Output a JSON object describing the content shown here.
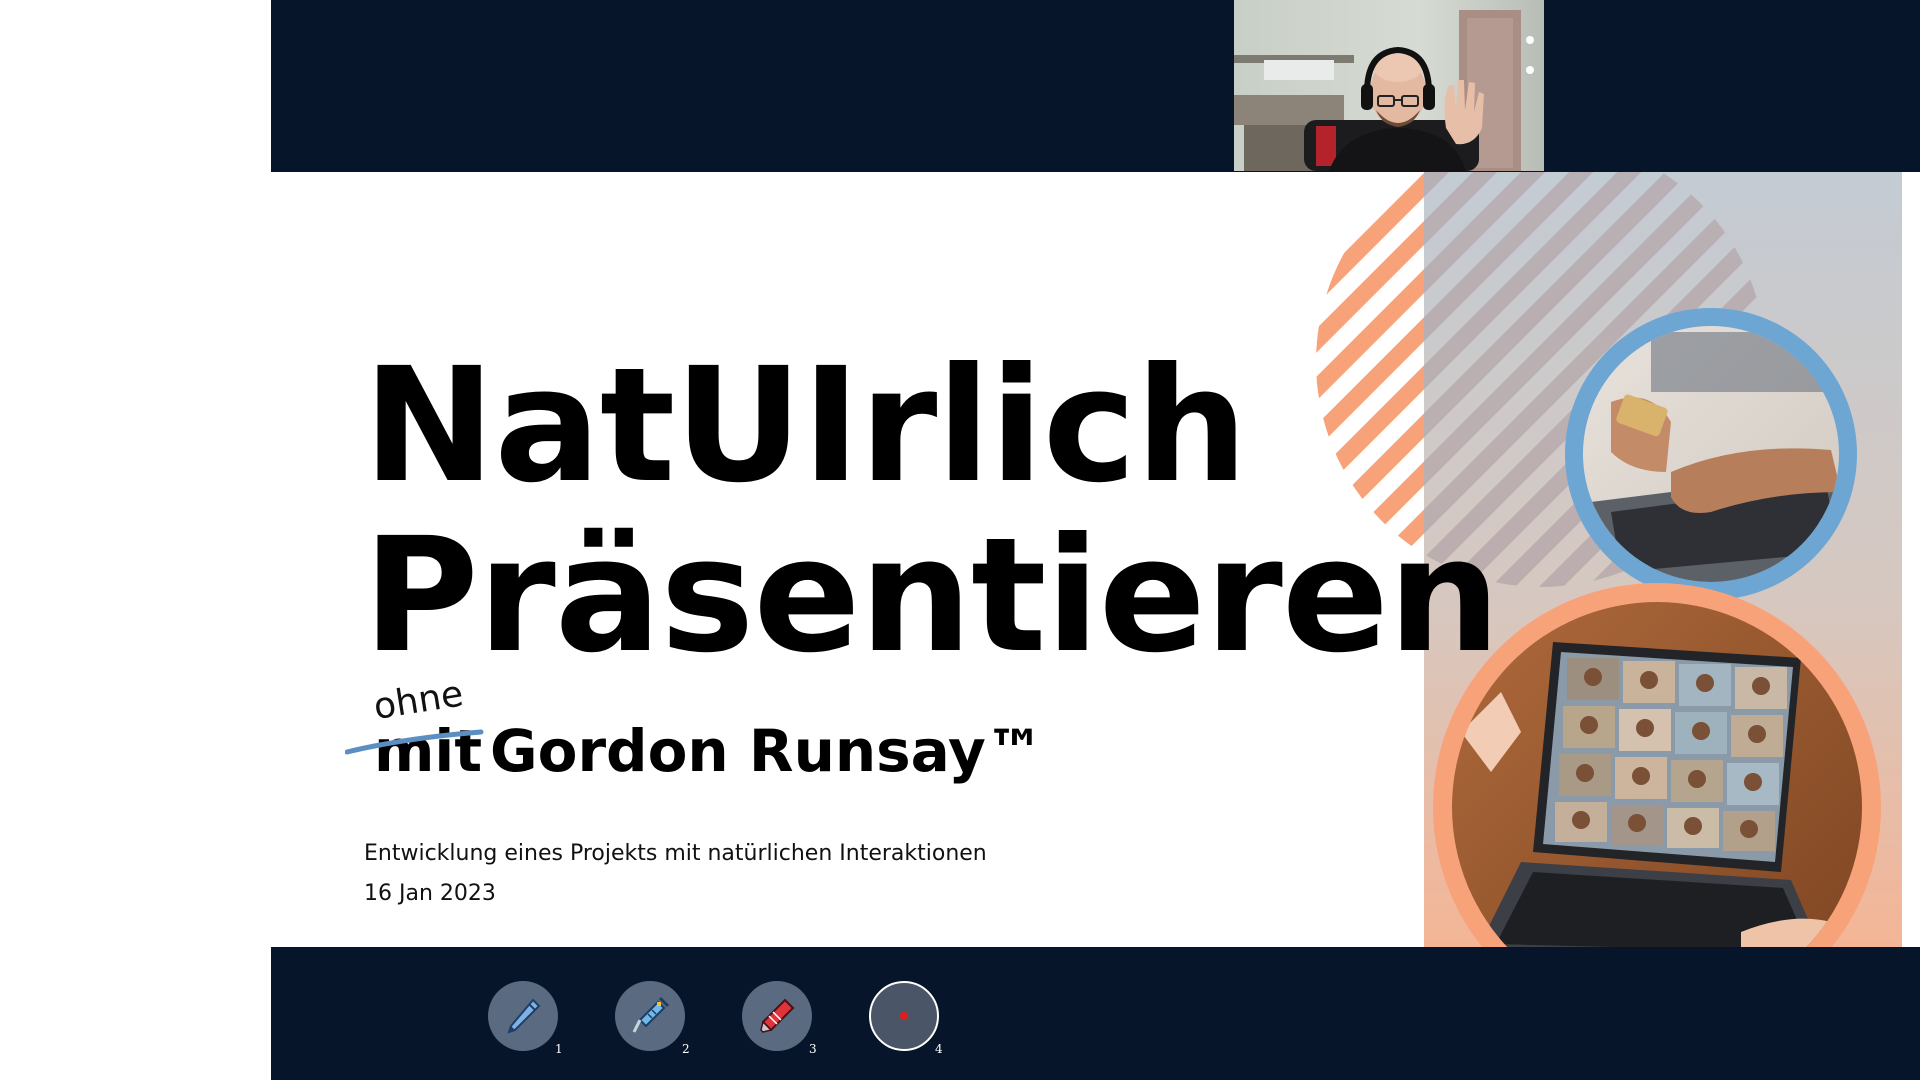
{
  "slide": {
    "title_line1": "NatUIrlich",
    "title_line2": "Präsentieren",
    "struck_word": "mit",
    "replacement_word": "ohne",
    "name": "Gordon Runsay™",
    "description": "Entwicklung eines Projekts mit natürlichen Interaktionen",
    "date": "16 Jan 2023"
  },
  "toolbar": {
    "tools": [
      {
        "number": "1",
        "icon": "pen-icon"
      },
      {
        "number": "2",
        "icon": "syringe-icon"
      },
      {
        "number": "3",
        "icon": "marker-icon"
      },
      {
        "number": "4",
        "icon": "laser-pointer-icon"
      }
    ],
    "selected": "4"
  },
  "colors": {
    "band": "#061529",
    "accent_orange": "#f8a27a",
    "accent_blue": "#6ea6d3",
    "laser_red": "#e31b1b"
  }
}
